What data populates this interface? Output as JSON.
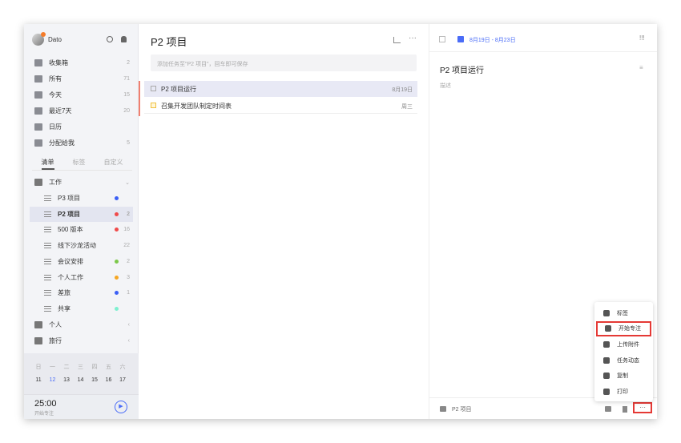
{
  "user": {
    "name": "Dato"
  },
  "smart_lists": [
    {
      "label": "收集箱",
      "count": "2",
      "icon": "inbox-icon"
    },
    {
      "label": "所有",
      "count": "71",
      "icon": "all-icon"
    },
    {
      "label": "今天",
      "count": "15",
      "icon": "today-icon"
    },
    {
      "label": "最近7天",
      "count": "20",
      "icon": "week-icon"
    },
    {
      "label": "日历",
      "count": "",
      "icon": "calendar-icon"
    },
    {
      "label": "分配给我",
      "count": "5",
      "icon": "assigned-icon"
    }
  ],
  "tabs": [
    "清单",
    "标签",
    "自定义"
  ],
  "folders": [
    {
      "label": "工作",
      "lists": [
        {
          "label": "P3 项目",
          "color": "#3b5ff5",
          "count": ""
        },
        {
          "label": "P2 项目",
          "color": "#f04a4a",
          "count": "2",
          "selected": true
        },
        {
          "label": "500 版本",
          "color": "#f04a4a",
          "count": "16"
        },
        {
          "label": "线下沙龙活动",
          "color": "",
          "count": "22"
        },
        {
          "label": "会议安排",
          "color": "#7cc84a",
          "count": "2"
        },
        {
          "label": "个人工作",
          "color": "#f5a623",
          "count": "3"
        },
        {
          "label": "差旅",
          "color": "#3b5ff5",
          "count": "1"
        },
        {
          "label": "共享",
          "color": "#7ef0d0",
          "count": ""
        }
      ]
    },
    {
      "label": "个人"
    },
    {
      "label": "旅行"
    }
  ],
  "calendar": {
    "weekdays": [
      "日",
      "一",
      "二",
      "三",
      "四",
      "五",
      "六"
    ],
    "days": [
      "11",
      "12",
      "13",
      "14",
      "15",
      "16",
      "17"
    ]
  },
  "timer": {
    "time": "25:00",
    "label": "开始专注"
  },
  "middle": {
    "title": "P2 项目",
    "add_placeholder": "添加任务至\"P2 项目\"，回车即可保存",
    "tasks": [
      {
        "title": "P2 项目运行",
        "date": "8月19日"
      },
      {
        "title": "召集开发团队制定时间表",
        "date": "周三"
      }
    ]
  },
  "detail": {
    "date_range": "8月19日 - 8月23日",
    "title": "P2 项目运行",
    "desc_placeholder": "描述",
    "list": "P2 项目"
  },
  "menu": [
    "标签",
    "开始专注",
    "上传附件",
    "任务动态",
    "复制",
    "打印"
  ],
  "colors": {
    "accent": "#4a6cf7",
    "highlight": "#e53935"
  }
}
